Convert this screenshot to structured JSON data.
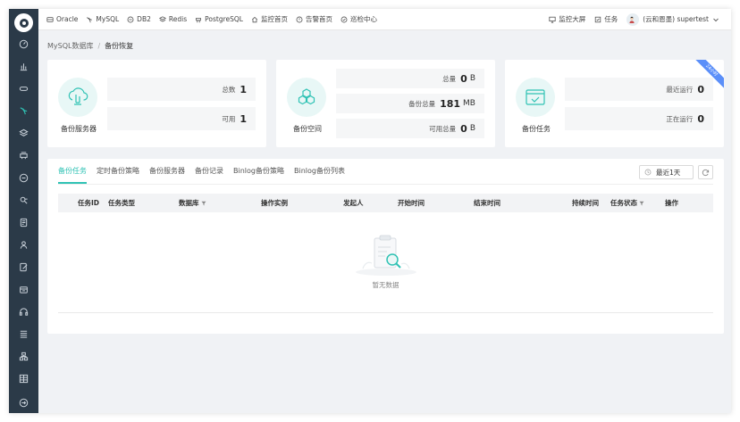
{
  "topnav": {
    "items": [
      "Oracle",
      "MySQL",
      "DB2",
      "Redis",
      "PostgreSQL",
      "监控首页",
      "告警首页",
      "巡检中心"
    ],
    "right": {
      "monitor_screen": "监控大屏",
      "tasks": "任务",
      "user": "(云和恩墨) supertest"
    }
  },
  "breadcrumb": {
    "parent": "MySQL数据库",
    "separator": "/",
    "current": "备份恢复"
  },
  "cards": {
    "server": {
      "title": "备份服务器",
      "total_label": "总数",
      "total_value": "1",
      "available_label": "可用",
      "available_value": "1"
    },
    "space": {
      "title": "备份空间",
      "total_label": "总量",
      "total_value": "0",
      "total_unit": "B",
      "backup_total_label": "备份总量",
      "backup_total_value": "181",
      "backup_total_unit": "MB",
      "available_total_label": "可用总量",
      "available_total_value": "0",
      "available_total_unit": "B"
    },
    "tasks": {
      "title": "备份任务",
      "recent_label": "最近运行",
      "recent_value": "0",
      "running_label": "正在运行",
      "running_value": "0",
      "ribbon": "24小时"
    }
  },
  "panel": {
    "tabs": [
      "备份任务",
      "定时备份策略",
      "备份服务器",
      "备份记录",
      "Binlog备份策略",
      "Binlog备份列表"
    ],
    "active_tab": 0,
    "range_button": "最近1天",
    "columns": [
      "任务ID",
      "任务类型",
      "数据库",
      "操作实例",
      "发起人",
      "开始时间",
      "结束时间",
      "持续时间",
      "任务状态",
      "操作"
    ],
    "empty_text": "暂无数据"
  },
  "colors": {
    "accent": "#2fc2b4",
    "sidebar": "#2b3a48",
    "ribbon": "#5b8ff9"
  }
}
